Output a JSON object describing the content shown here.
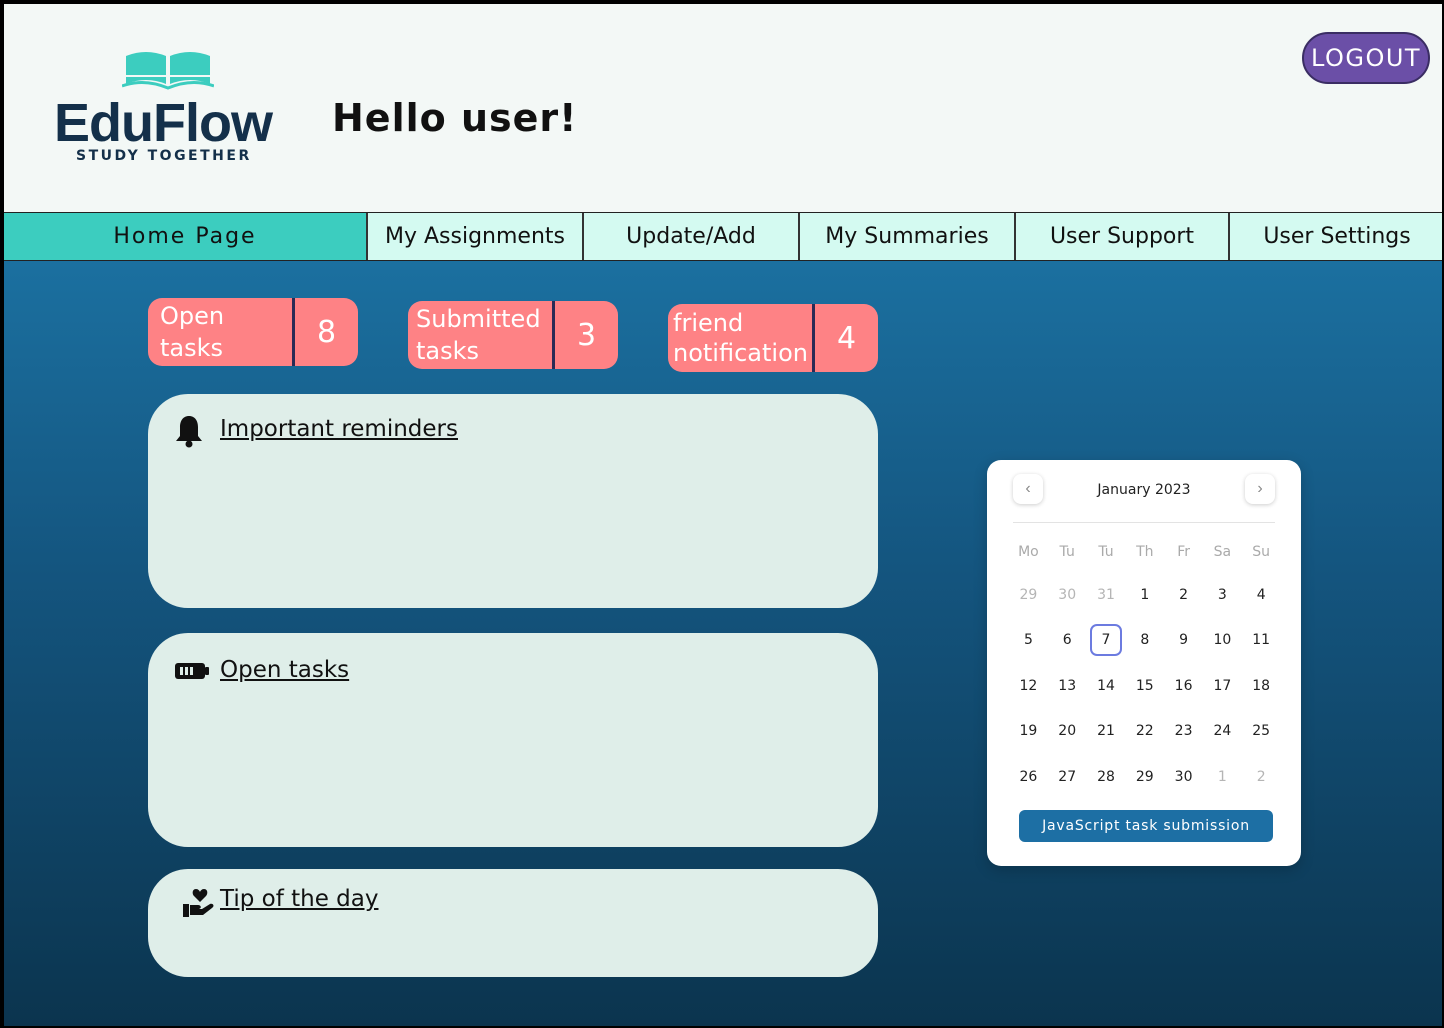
{
  "app": {
    "logo_name": "EduFlow",
    "logo_tagline": "STUDY TOGETHER",
    "greeting": "Hello user!",
    "logout_label": "LOGOUT",
    "brand_color": "#3ccdbf",
    "logout_color": "#6b4fa7"
  },
  "nav": {
    "items": [
      {
        "label": "Home Page",
        "active": true
      },
      {
        "label": "My Assignments"
      },
      {
        "label": "Update/Add"
      },
      {
        "label": "My Summaries"
      },
      {
        "label": "User Support"
      },
      {
        "label": "User Settings"
      }
    ]
  },
  "stats": [
    {
      "line1": "Open",
      "line2": "tasks",
      "count": "8"
    },
    {
      "line1": "Submitted",
      "line2": "tasks",
      "count": "3"
    },
    {
      "line1": "friend",
      "line2": "notification",
      "count": "4"
    }
  ],
  "cards": {
    "reminders": {
      "title": "Important reminders",
      "icon": "bell-icon"
    },
    "open_tasks": {
      "title": "Open tasks",
      "icon": "battery-icon"
    },
    "tip": {
      "title": "Tip of the day",
      "icon": "hand-heart-icon"
    }
  },
  "calendar": {
    "month": "January 2023",
    "weekdays": [
      "Mo",
      "Tu",
      "Tu",
      "Th",
      "Fr",
      "Sa",
      "Su"
    ],
    "days": [
      {
        "d": "29",
        "muted": true
      },
      {
        "d": "30",
        "muted": true
      },
      {
        "d": "31",
        "muted": true
      },
      {
        "d": "1"
      },
      {
        "d": "2"
      },
      {
        "d": "3"
      },
      {
        "d": "4"
      },
      {
        "d": "5"
      },
      {
        "d": "6"
      },
      {
        "d": "7",
        "today": true
      },
      {
        "d": "8"
      },
      {
        "d": "9"
      },
      {
        "d": "10"
      },
      {
        "d": "11"
      },
      {
        "d": "12"
      },
      {
        "d": "13"
      },
      {
        "d": "14"
      },
      {
        "d": "15"
      },
      {
        "d": "16"
      },
      {
        "d": "17"
      },
      {
        "d": "18"
      },
      {
        "d": "19"
      },
      {
        "d": "20"
      },
      {
        "d": "21"
      },
      {
        "d": "22"
      },
      {
        "d": "23"
      },
      {
        "d": "24"
      },
      {
        "d": "25"
      },
      {
        "d": "26"
      },
      {
        "d": "27"
      },
      {
        "d": "28"
      },
      {
        "d": "29"
      },
      {
        "d": "30"
      },
      {
        "d": "1",
        "muted": true
      },
      {
        "d": "2",
        "muted": true
      }
    ],
    "button_label": "JavaScript task submission",
    "prev_icon": "chevron-left-icon",
    "next_icon": "chevron-right-icon"
  }
}
